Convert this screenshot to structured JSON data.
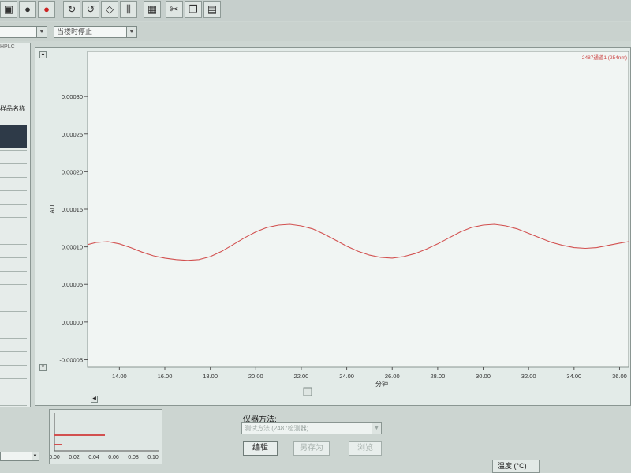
{
  "toolbar": {
    "buttons": [
      {
        "name": "save-icon",
        "glyph": "▣"
      },
      {
        "name": "record-icon",
        "glyph": "●"
      },
      {
        "name": "stop-icon",
        "glyph": "●"
      },
      {
        "name": "tool-a-icon",
        "glyph": "↻"
      },
      {
        "name": "tool-b-icon",
        "glyph": "↺"
      },
      {
        "name": "tool-c-icon",
        "glyph": "◇"
      },
      {
        "name": "tool-d-icon",
        "glyph": "⫼"
      },
      {
        "name": "calculator-icon",
        "glyph": "▦"
      },
      {
        "name": "cut-icon",
        "glyph": "✂"
      },
      {
        "name": "copy-icon",
        "glyph": "❐"
      },
      {
        "name": "paste-icon",
        "glyph": "▤"
      }
    ]
  },
  "controls": {
    "stop_mode_value": "当楼时停止"
  },
  "left_panel": {
    "header": "HPLC",
    "column_label": "样品名称"
  },
  "chart_data": {
    "type": "line",
    "ylabel": "AU",
    "xlabel": "分钟",
    "xlim": [
      12.6,
      36.4
    ],
    "ylim": [
      -6e-05,
      0.00036
    ],
    "x_ticks": [
      "14.00",
      "16.00",
      "18.00",
      "20.00",
      "22.00",
      "24.00",
      "26.00",
      "28.00",
      "30.00",
      "32.00",
      "34.00",
      "36.00"
    ],
    "y_ticks": [
      "0.00030",
      "0.00025",
      "0.00020",
      "0.00015",
      "0.00010",
      "0.00005",
      "0.00000",
      "-0.00005"
    ],
    "series": [
      {
        "color": "#d2504f",
        "x": [
          12.6,
          13.0,
          13.5,
          14.0,
          14.5,
          15.0,
          15.5,
          16.0,
          16.5,
          17.0,
          17.5,
          18.0,
          18.5,
          19.0,
          19.5,
          20.0,
          20.5,
          21.0,
          21.5,
          22.0,
          22.5,
          23.0,
          23.5,
          24.0,
          24.5,
          25.0,
          25.5,
          26.0,
          26.5,
          27.0,
          27.5,
          28.0,
          28.5,
          29.0,
          29.5,
          30.0,
          30.5,
          31.0,
          31.5,
          32.0,
          32.5,
          33.0,
          33.5,
          34.0,
          34.5,
          35.0,
          35.5,
          36.0,
          36.4
        ],
        "y": [
          0.000103,
          0.000106,
          0.000107,
          0.000104,
          9.9e-05,
          9.3e-05,
          8.8e-05,
          8.5e-05,
          8.3e-05,
          8.2e-05,
          8.3e-05,
          8.7e-05,
          9.4e-05,
          0.000103,
          0.000112,
          0.00012,
          0.000126,
          0.000129,
          0.00013,
          0.000128,
          0.000124,
          0.000117,
          0.000109,
          0.000101,
          9.4e-05,
          8.9e-05,
          8.6e-05,
          8.5e-05,
          8.7e-05,
          9.1e-05,
          9.7e-05,
          0.000104,
          0.000112,
          0.00012,
          0.000126,
          0.000129,
          0.00013,
          0.000128,
          0.000124,
          0.000118,
          0.000112,
          0.000106,
          0.000102,
          9.9e-05,
          9.8e-05,
          9.9e-05,
          0.000102,
          0.000105,
          0.000107
        ]
      }
    ],
    "grid": false,
    "legend": "none",
    "corner_label": "2487通道1 (254nm)"
  },
  "bottom": {
    "mini_chart": {
      "x_ticks": [
        "0.00",
        "0.02",
        "0.04",
        "0.06",
        "0.08",
        "0.10"
      ]
    },
    "method_label": "仪器方法:",
    "method_placeholder": "测试方法 (2487检测器)",
    "edit_button": "编辑",
    "button_2": "另存为",
    "button_3": "浏览",
    "temperature_label": "温度 (°C)"
  }
}
